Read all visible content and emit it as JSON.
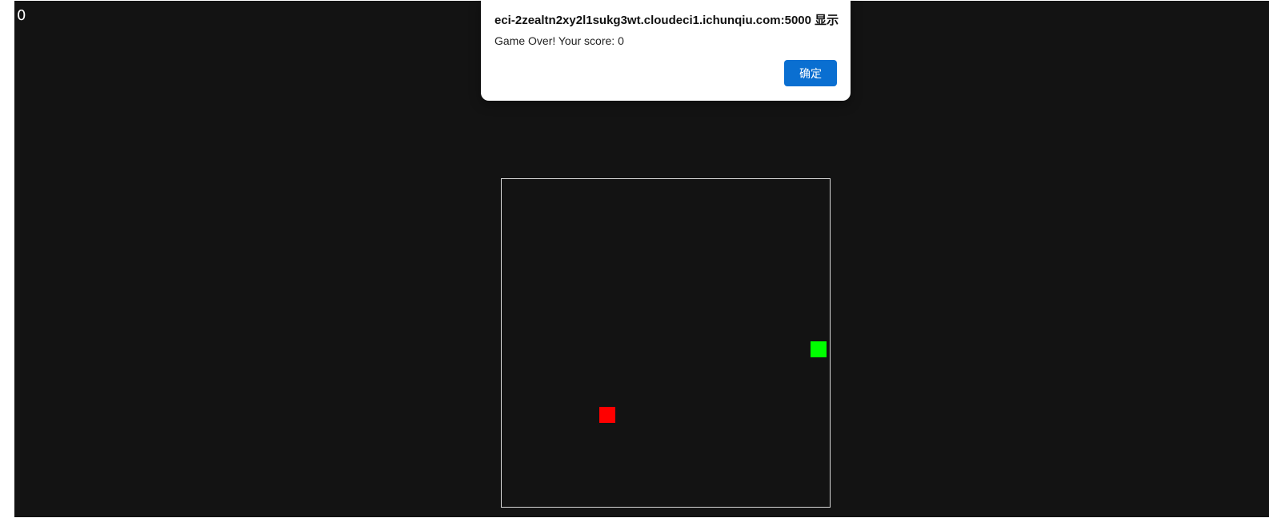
{
  "game": {
    "score": "0",
    "snake_color": "#00ff00",
    "food_color": "#ff0000"
  },
  "alert": {
    "title": "eci-2zealtn2xy2l1sukg3wt.cloudeci1.ichunqiu.com:5000 显示",
    "message": "Game Over! Your score: 0",
    "ok_label": "确定"
  }
}
